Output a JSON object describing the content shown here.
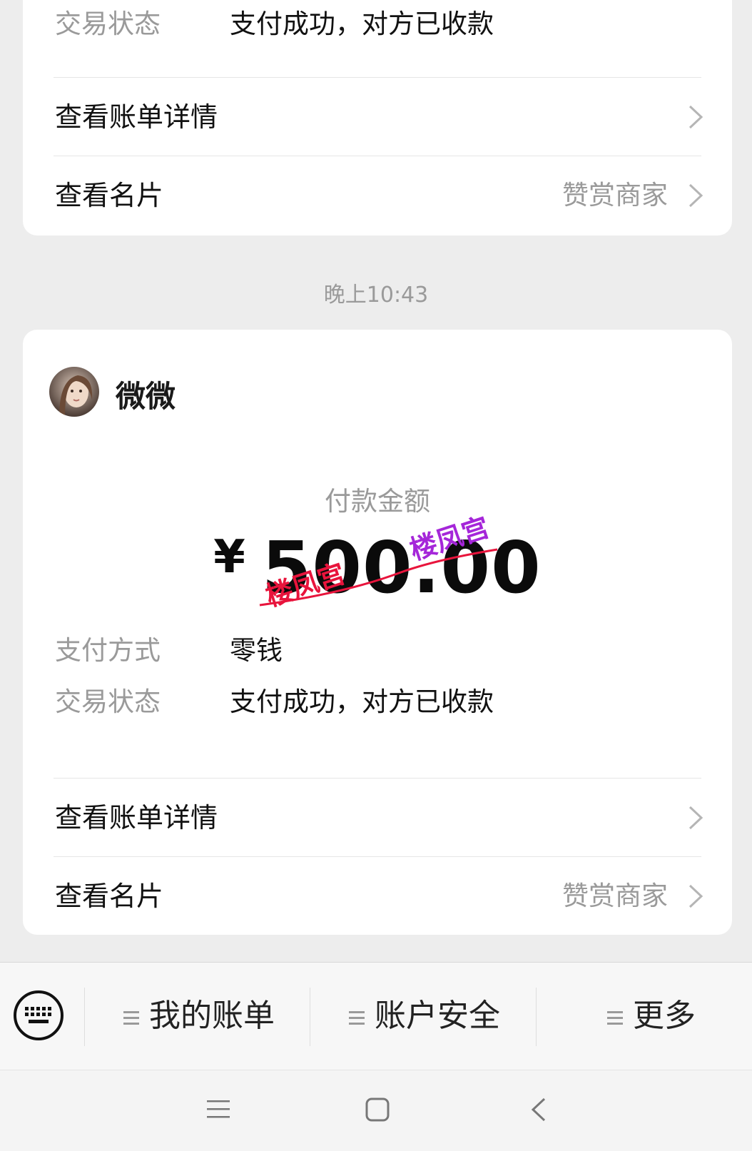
{
  "top_card": {
    "status_key": "交易状态",
    "status_value": "支付成功，对方已收款",
    "bill_detail_label": "查看账单详情",
    "card_label": "查看名片",
    "merchant_label": "赞赏商家"
  },
  "timestamp": "晚上10:43",
  "main_card": {
    "payer_name": "微微",
    "amount_label": "付款金额",
    "currency": "¥",
    "amount": "500.00",
    "watermark": "楼凤宫",
    "method_key": "支付方式",
    "method_value": "零钱",
    "status_key": "交易状态",
    "status_value": "支付成功，对方已收款",
    "bill_detail_label": "查看账单详情",
    "card_label": "查看名片",
    "merchant_label": "赞赏商家"
  },
  "menu": {
    "items": [
      {
        "label": "我的账单",
        "icon": "hamburger-icon"
      },
      {
        "label": "账户安全",
        "icon": "hamburger-icon"
      },
      {
        "label": "更多",
        "icon": "hamburger-icon"
      }
    ],
    "keyboard_icon": "keyboard-icon"
  },
  "nav": {
    "icons": [
      "menu-icon",
      "home-icon",
      "back-icon"
    ]
  },
  "colors": {
    "background": "#ededed",
    "card": "#ffffff",
    "muted_text": "#9a9a9a",
    "watermark_red": "#e8143c",
    "watermark_purple": "#a526d9"
  }
}
